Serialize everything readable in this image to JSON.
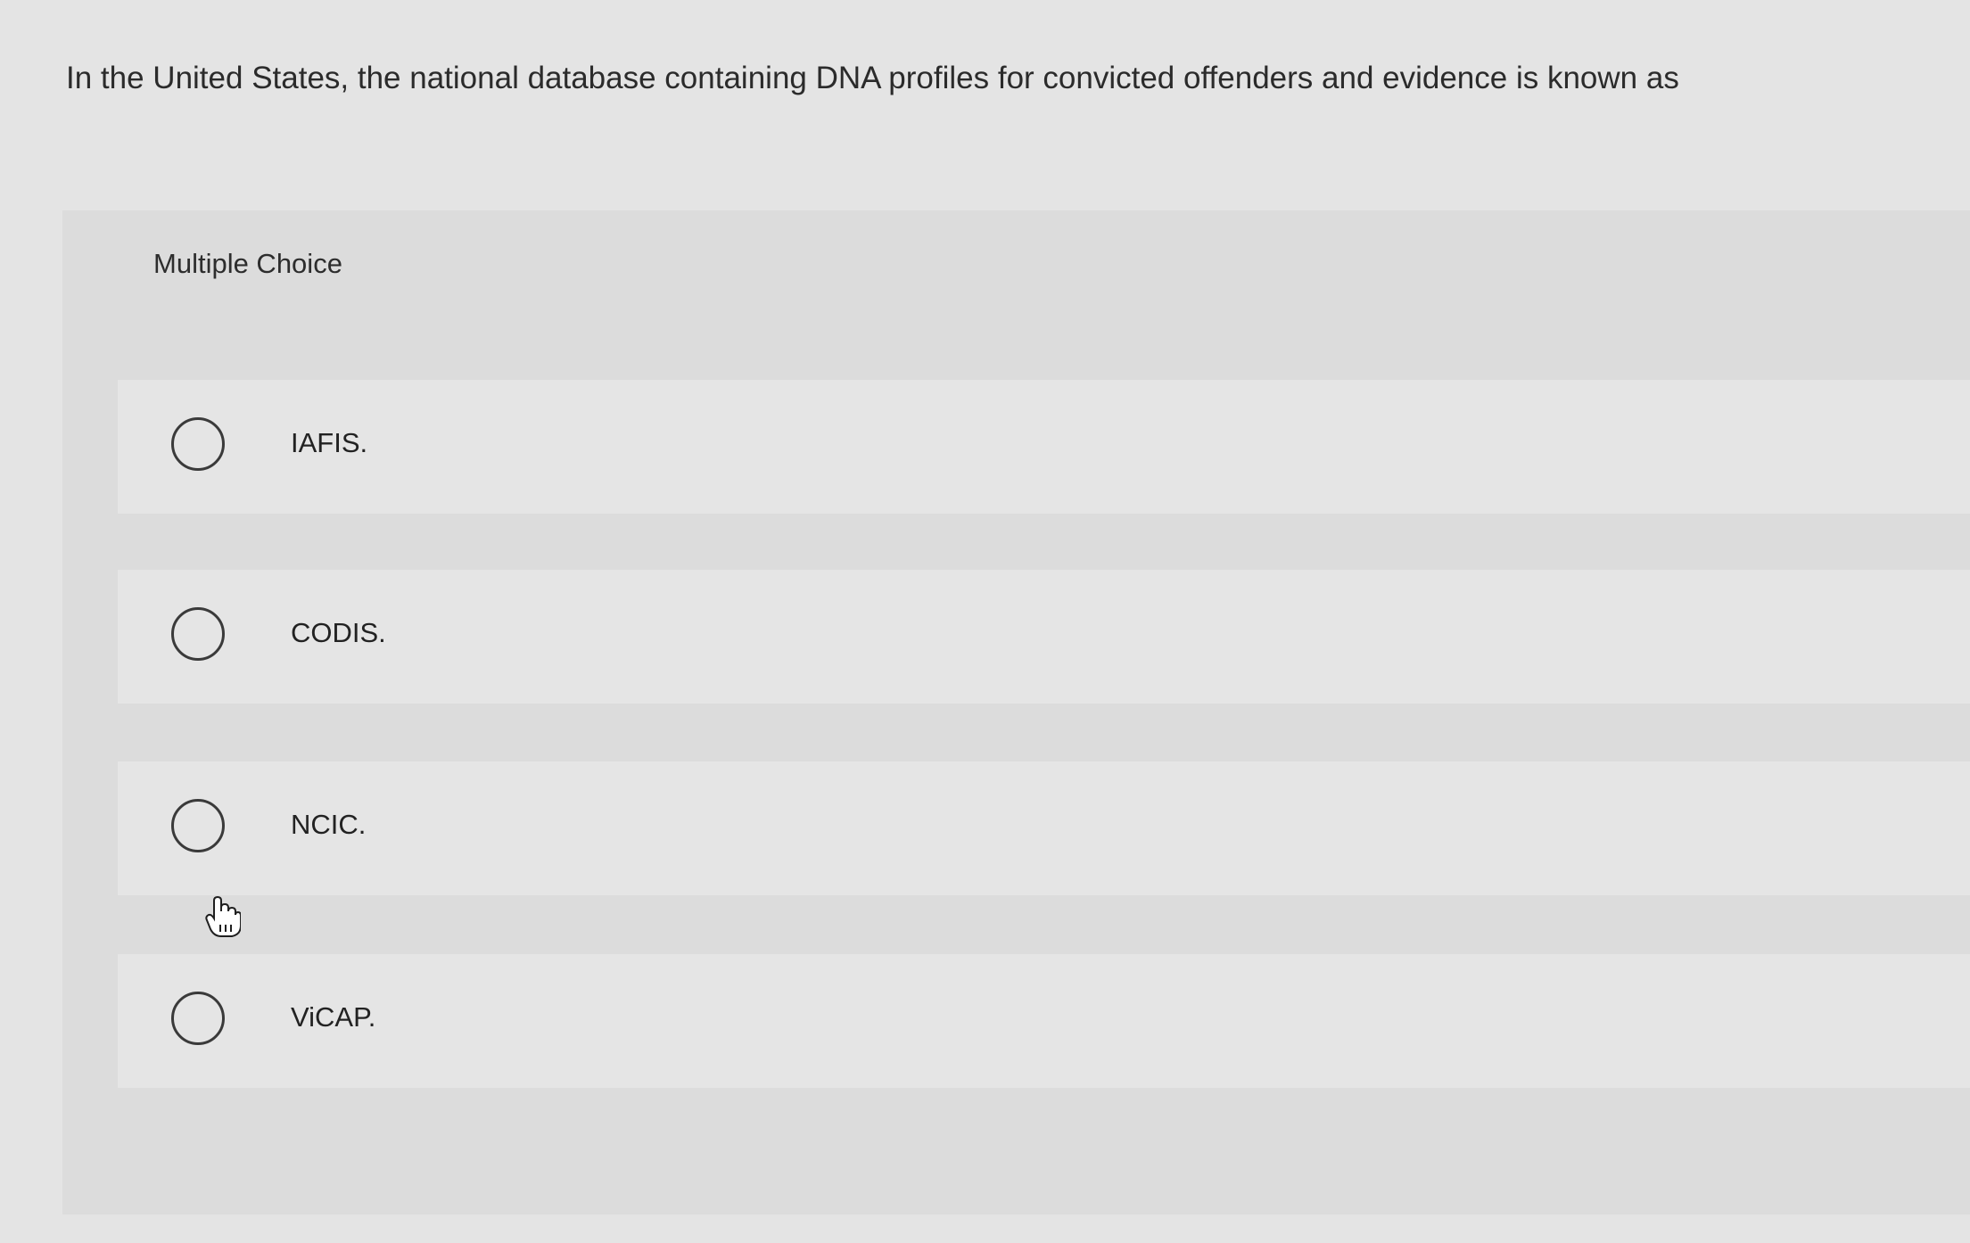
{
  "question": {
    "text": "In the United States, the national database containing DNA profiles for convicted offenders and evidence is known as"
  },
  "choice_panel": {
    "label": "Multiple Choice",
    "options": [
      {
        "label": "IAFIS.",
        "selected": false
      },
      {
        "label": "CODIS.",
        "selected": false
      },
      {
        "label": "NCIC.",
        "selected": false
      },
      {
        "label": "ViCAP.",
        "selected": false
      }
    ]
  },
  "cursor": {
    "icon": "hand-pointer-icon"
  }
}
